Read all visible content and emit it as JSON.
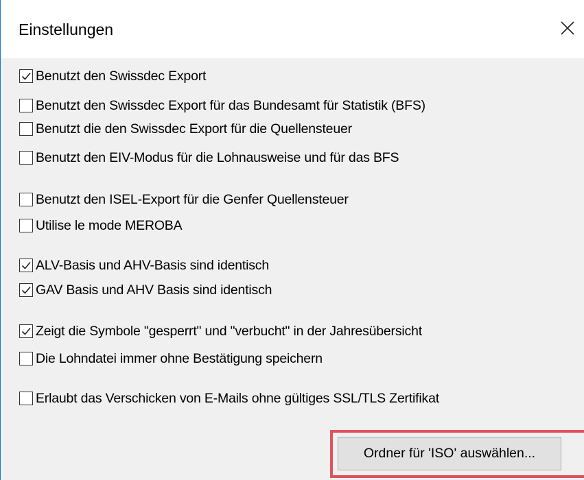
{
  "window": {
    "title": "Einstellungen"
  },
  "options": [
    {
      "label": "Benutzt den Swissdec Export",
      "checked": true
    },
    {
      "label": "Benutzt den Swissdec Export für das Bundesamt für Statistik (BFS)",
      "checked": false
    },
    {
      "label": "Benutzt die den Swissdec Export für die Quellensteuer",
      "checked": false
    },
    {
      "label": "Benutzt den EIV-Modus für die Lohnausweise und für das BFS",
      "checked": false
    },
    {
      "label": "Benutzt den ISEL-Export für die Genfer Quellensteuer",
      "checked": false
    },
    {
      "label": "Utilise le mode MEROBA",
      "checked": false
    },
    {
      "label": "ALV-Basis und AHV-Basis sind identisch",
      "checked": true
    },
    {
      "label": "GAV Basis und AHV Basis sind identisch",
      "checked": true
    },
    {
      "label": "Zeigt die Symbole \"gesperrt\" und \"verbucht\" in der Jahresübersicht",
      "checked": true
    },
    {
      "label": "Die Lohndatei immer ohne Bestätigung speichern",
      "checked": false
    },
    {
      "label": "Erlaubt das Verschicken von E-Mails ohne gültiges SSL/TLS Zertifikat",
      "checked": false
    }
  ],
  "buttons": {
    "select_iso_folder": "Ordner für 'ISO' auswählen..."
  },
  "colors": {
    "highlight": "#e0525a",
    "window_border": "#1979ca"
  }
}
